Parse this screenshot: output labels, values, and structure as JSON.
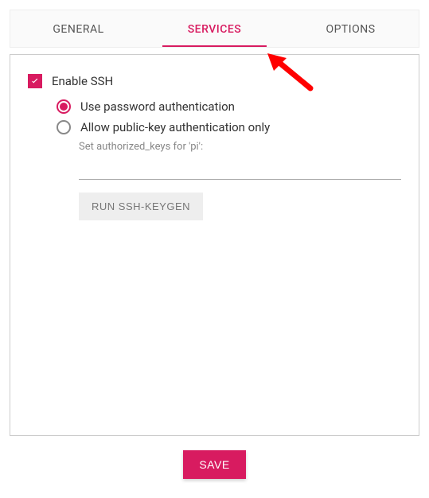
{
  "tabs": {
    "general": "GENERAL",
    "services": "SERVICES",
    "options": "OPTIONS",
    "active": "services"
  },
  "ssh": {
    "enable_label": "Enable SSH",
    "enabled": true,
    "auth_password_label": "Use password authentication",
    "auth_pubkey_label": "Allow public-key authentication only",
    "auth_selected": "password",
    "authorized_keys_hint": "Set authorized_keys for 'pi':",
    "authorized_keys_value": "",
    "keygen_button": "RUN SSH-KEYGEN"
  },
  "save_button": "SAVE",
  "annotation": {
    "type": "arrow",
    "color": "#ff0000",
    "points_to": "tab-services"
  }
}
